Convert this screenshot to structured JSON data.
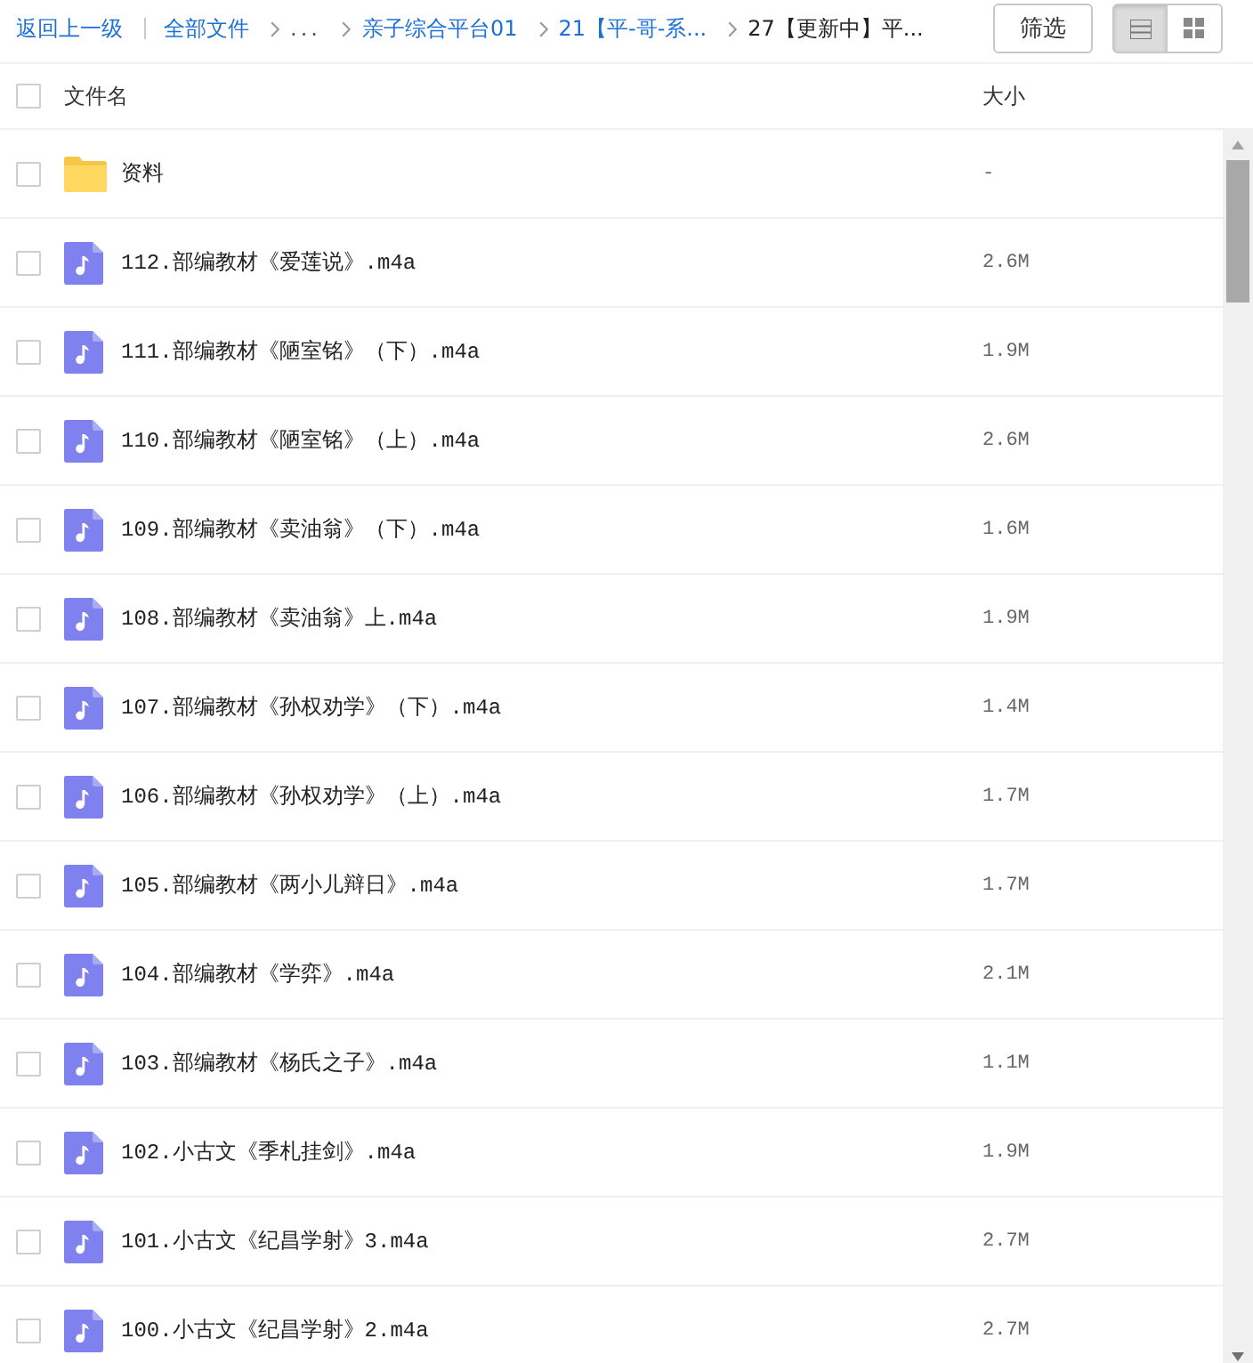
{
  "toolbar": {
    "back_link": "返回上一级",
    "breadcrumbs": [
      {
        "kind": "link",
        "label": "全部文件"
      },
      {
        "kind": "collapsed",
        "label": "..."
      },
      {
        "kind": "link",
        "label": "亲子综合平台01"
      },
      {
        "kind": "link",
        "label": "21【平-哥-系..."
      },
      {
        "kind": "current",
        "label": "27【更新中】平..."
      }
    ],
    "filter_button": "筛选",
    "view_modes": [
      {
        "kind": "list",
        "selected": true
      },
      {
        "kind": "grid",
        "selected": false
      }
    ]
  },
  "columns": {
    "select_all_checked": false,
    "name": "文件名",
    "size": "大小"
  },
  "files": [
    {
      "kind": "folder",
      "name": "资料",
      "size": "-",
      "checked": false
    },
    {
      "kind": "audio",
      "name": "112.部编教材《爱莲说》.m4a",
      "size": "2.6M",
      "checked": false
    },
    {
      "kind": "audio",
      "name": "111.部编教材《陋室铭》（下）.m4a",
      "size": "1.9M",
      "checked": false
    },
    {
      "kind": "audio",
      "name": "110.部编教材《陋室铭》（上）.m4a",
      "size": "2.6M",
      "checked": false
    },
    {
      "kind": "audio",
      "name": "109.部编教材《卖油翁》（下）.m4a",
      "size": "1.6M",
      "checked": false
    },
    {
      "kind": "audio",
      "name": "108.部编教材《卖油翁》上.m4a",
      "size": "1.9M",
      "checked": false
    },
    {
      "kind": "audio",
      "name": "107.部编教材《孙权劝学》（下）.m4a",
      "size": "1.4M",
      "checked": false
    },
    {
      "kind": "audio",
      "name": "106.部编教材《孙权劝学》（上）.m4a",
      "size": "1.7M",
      "checked": false
    },
    {
      "kind": "audio",
      "name": "105.部编教材《两小儿辩日》.m4a",
      "size": "1.7M",
      "checked": false
    },
    {
      "kind": "audio",
      "name": "104.部编教材《学弈》.m4a",
      "size": "2.1M",
      "checked": false
    },
    {
      "kind": "audio",
      "name": "103.部编教材《杨氏之子》.m4a",
      "size": "1.1M",
      "checked": false
    },
    {
      "kind": "audio",
      "name": "102.小古文《季札挂剑》.m4a",
      "size": "1.9M",
      "checked": false
    },
    {
      "kind": "audio",
      "name": "101.小古文《纪昌学射》3.m4a",
      "size": "2.7M",
      "checked": false
    },
    {
      "kind": "audio",
      "name": "100.小古文《纪昌学射》2.m4a",
      "size": "2.7M",
      "checked": false
    }
  ]
}
